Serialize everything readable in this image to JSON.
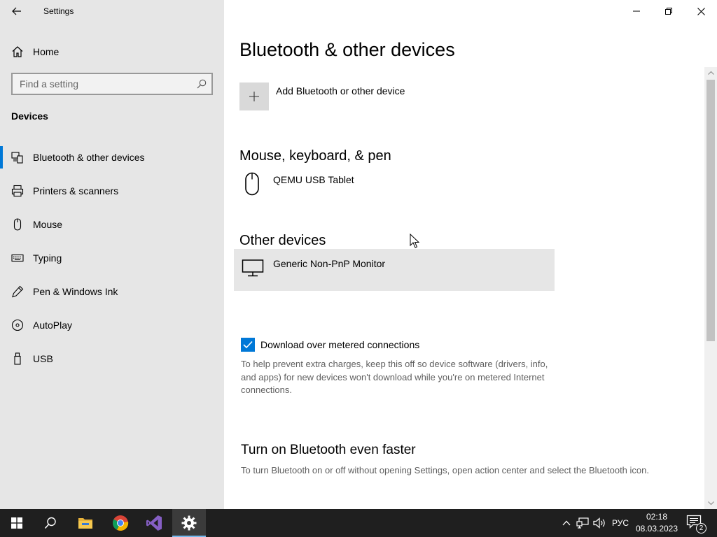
{
  "window": {
    "app_title": "Settings",
    "back_icon": "back-arrow-icon",
    "controls": [
      "minimize-icon",
      "restore-icon",
      "close-icon"
    ]
  },
  "sidebar": {
    "home_label": "Home",
    "search_placeholder": "Find a setting",
    "section_header": "Devices",
    "items": [
      {
        "label": "Bluetooth & other devices",
        "icon": "bluetooth-devices-icon",
        "active": true
      },
      {
        "label": "Printers & scanners",
        "icon": "printer-icon",
        "active": false
      },
      {
        "label": "Mouse",
        "icon": "mouse-icon",
        "active": false
      },
      {
        "label": "Typing",
        "icon": "keyboard-icon",
        "active": false
      },
      {
        "label": "Pen & Windows Ink",
        "icon": "pen-icon",
        "active": false
      },
      {
        "label": "AutoPlay",
        "icon": "autoplay-icon",
        "active": false
      },
      {
        "label": "USB",
        "icon": "usb-icon",
        "active": false
      }
    ]
  },
  "main": {
    "title": "Bluetooth & other devices",
    "add_device_label": "Add Bluetooth or other device",
    "groups": [
      {
        "header": "Mouse, keyboard, & pen",
        "devices": [
          {
            "label": "QEMU USB Tablet",
            "icon": "mouse-icon"
          }
        ]
      },
      {
        "header": "Other devices",
        "devices": [
          {
            "label": "Generic Non-PnP Monitor",
            "icon": "monitor-icon"
          }
        ]
      }
    ],
    "metered": {
      "checked": true,
      "label": "Download over metered connections",
      "help": "To help prevent extra charges, keep this off so device software (drivers, info, and apps) for new devices won't download while you're on metered Internet connections."
    },
    "faster": {
      "header": "Turn on Bluetooth even faster",
      "help": "To turn Bluetooth on or off without opening Settings, open action center and select the Bluetooth icon."
    }
  },
  "taskbar": {
    "apps": [
      "start-icon",
      "search-icon",
      "file-explorer-icon",
      "chrome-icon",
      "visual-studio-icon",
      "settings-gear-icon"
    ],
    "active_app": "settings-gear-icon",
    "language": "РУС",
    "time": "02:18",
    "date": "08.03.2023",
    "notification_count": "2",
    "accent": "#0078d7"
  }
}
